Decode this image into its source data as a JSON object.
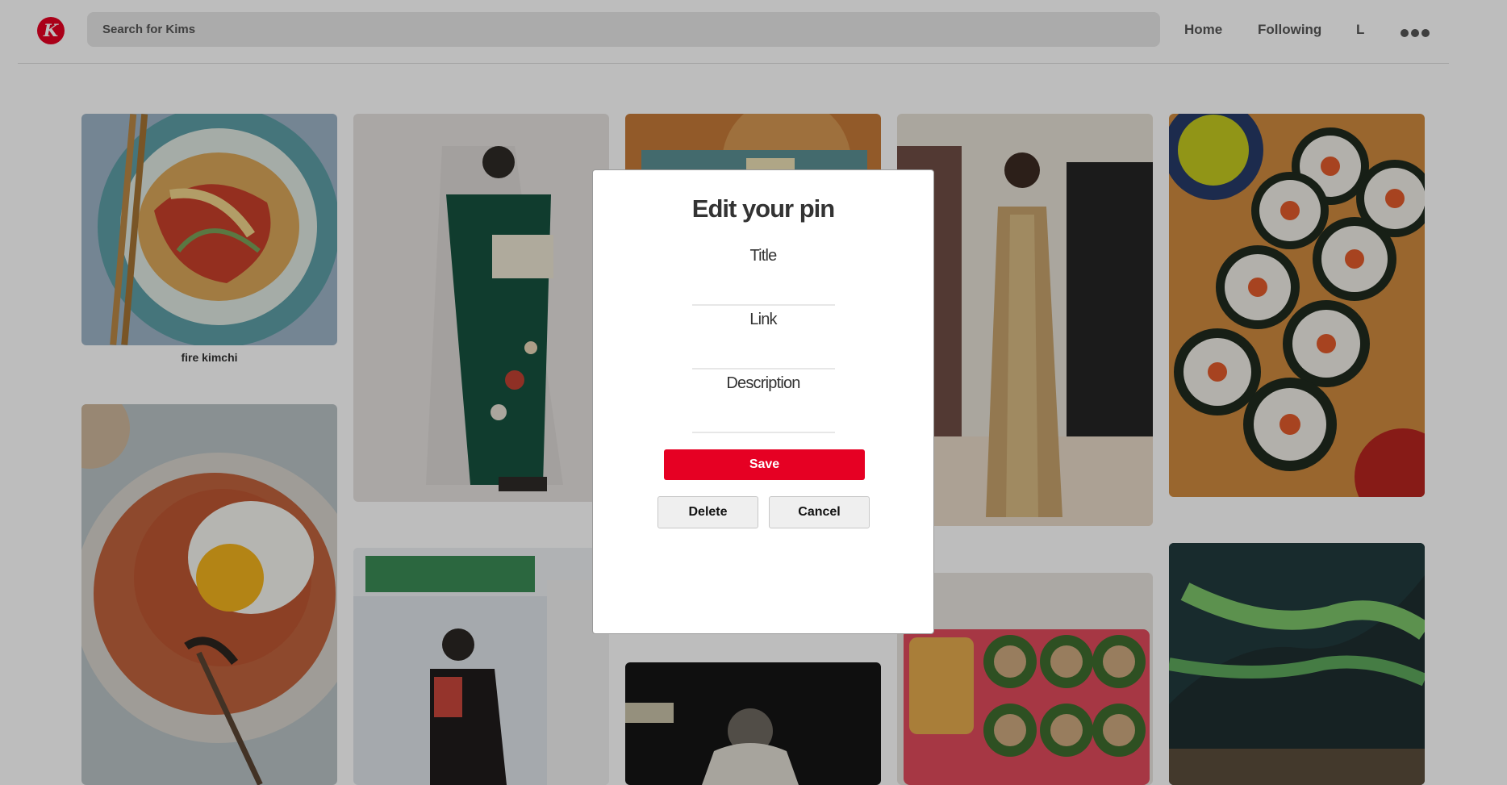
{
  "header": {
    "logo_letter": "K",
    "search_placeholder": "Search for Kims",
    "nav": {
      "home": "Home",
      "following": "Following",
      "user_initial": "L"
    }
  },
  "pins": [
    {
      "name": "pin-fire-kimchi",
      "caption": "fire kimchi"
    }
  ],
  "modal": {
    "title": "Edit your pin",
    "fields": {
      "title_label": "Title",
      "link_label": "Link",
      "description_label": "Description"
    },
    "buttons": {
      "save": "Save",
      "delete": "Delete",
      "cancel": "Cancel"
    }
  },
  "colors": {
    "brand": "#e60023",
    "overlay": "rgba(0,0,0,0.26)"
  },
  "icons": {
    "more": "ellipsis-icon"
  }
}
